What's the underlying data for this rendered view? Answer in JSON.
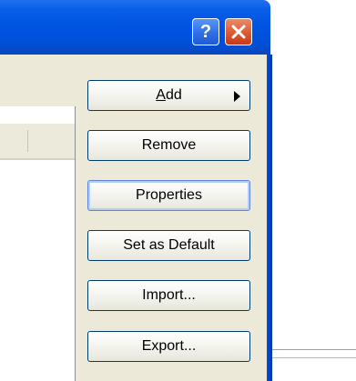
{
  "title_bar": {
    "help_button": {
      "icon": "help-icon",
      "glyph": "?"
    },
    "close_button": {
      "icon": "close-icon"
    }
  },
  "buttons": {
    "add": {
      "access_key": "A",
      "rest": "dd",
      "icon": "triangle-right-icon"
    },
    "remove": "Remove",
    "properties": "Properties",
    "set_as_default": "Set as Default",
    "import": "Import...",
    "export": "Export..."
  },
  "colors": {
    "title_bar": "#0054e3",
    "close_button": "#dd5a32",
    "dialog_face": "#ece9d8",
    "button_border": "#003c74"
  }
}
